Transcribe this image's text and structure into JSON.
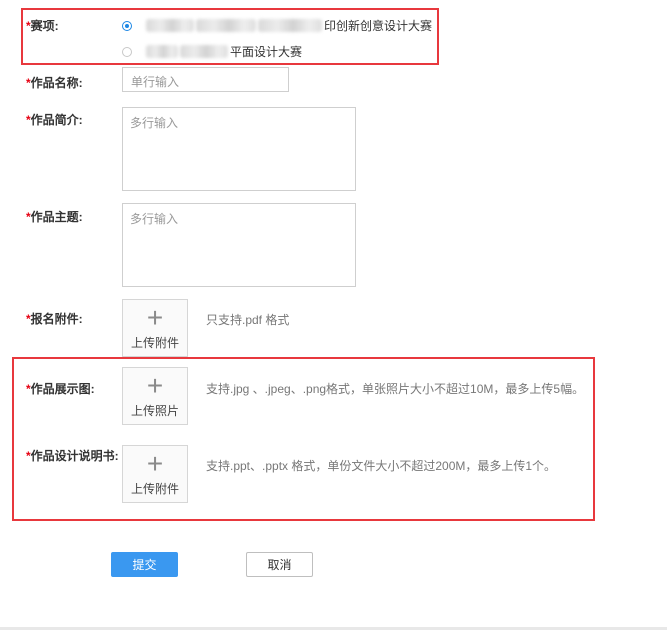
{
  "required_mark": "*",
  "competition": {
    "label": "赛项:",
    "options": [
      {
        "text": "印创新创意设计大赛",
        "selected": true
      },
      {
        "text": "平面设计大赛",
        "selected": false
      }
    ]
  },
  "fields": {
    "work_name": {
      "label": "作品名称:",
      "placeholder": "单行输入"
    },
    "work_intro": {
      "label": "作品简介:",
      "placeholder": "多行输入"
    },
    "work_theme": {
      "label": "作品主题:",
      "placeholder": "多行输入"
    },
    "attachment": {
      "label": "报名附件:",
      "upload_text": "上传附件",
      "hint": "只支持.pdf 格式"
    },
    "showcase": {
      "label": "作品展示图:",
      "upload_text": "上传照片",
      "hint": "支持.jpg 、.jpeg、.png格式，单张照片大小不超过10M，最多上传5幅。"
    },
    "design_doc": {
      "label": "作品设计说明书:",
      "upload_text": "上传附件",
      "hint": "支持.ppt、.pptx 格式，单份文件大小不超过200M，最多上传1个。"
    }
  },
  "actions": {
    "submit": "提交",
    "cancel": "取消"
  },
  "colors": {
    "required": "#e60012",
    "primary": "#3a98f0",
    "highlight": "#e8383d",
    "radio": "#1e88e5"
  }
}
